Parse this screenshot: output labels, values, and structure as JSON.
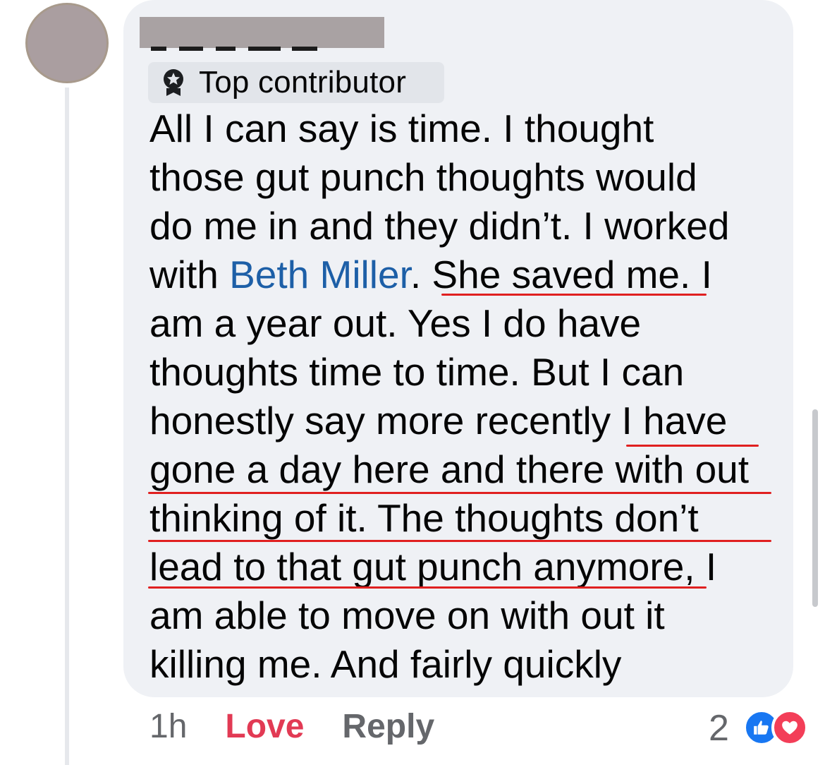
{
  "comment": {
    "badge_label": "Top contributor",
    "lines": [
      [
        "All I can say is time. I thought"
      ],
      [
        "those gut punch thoughts would"
      ],
      [
        "do me in and they didn’t. I worked"
      ],
      [
        "with ",
        "Beth Miller",
        ". She saved me. I"
      ],
      [
        "am a year out. Yes I do have"
      ],
      [
        "thoughts time to time. But I can"
      ],
      [
        "honestly say more recently I have"
      ],
      [
        "gone a day here and there with out"
      ],
      [
        "thinking of it. The thoughts don’t"
      ],
      [
        "lead to that gut punch anymore, I"
      ],
      [
        "am able to move on with out it"
      ],
      [
        "killing me. And fairly quickly"
      ]
    ]
  },
  "meta": {
    "time": "1h",
    "reaction_label": "Love",
    "reply_label": "Reply",
    "reaction_count": "2"
  },
  "colors": {
    "mention": "#1d5fa7",
    "love": "#e23a54",
    "annotation_underline": "#e02020"
  },
  "icons": [
    "badge-icon",
    "like-reaction-icon",
    "love-reaction-icon"
  ]
}
